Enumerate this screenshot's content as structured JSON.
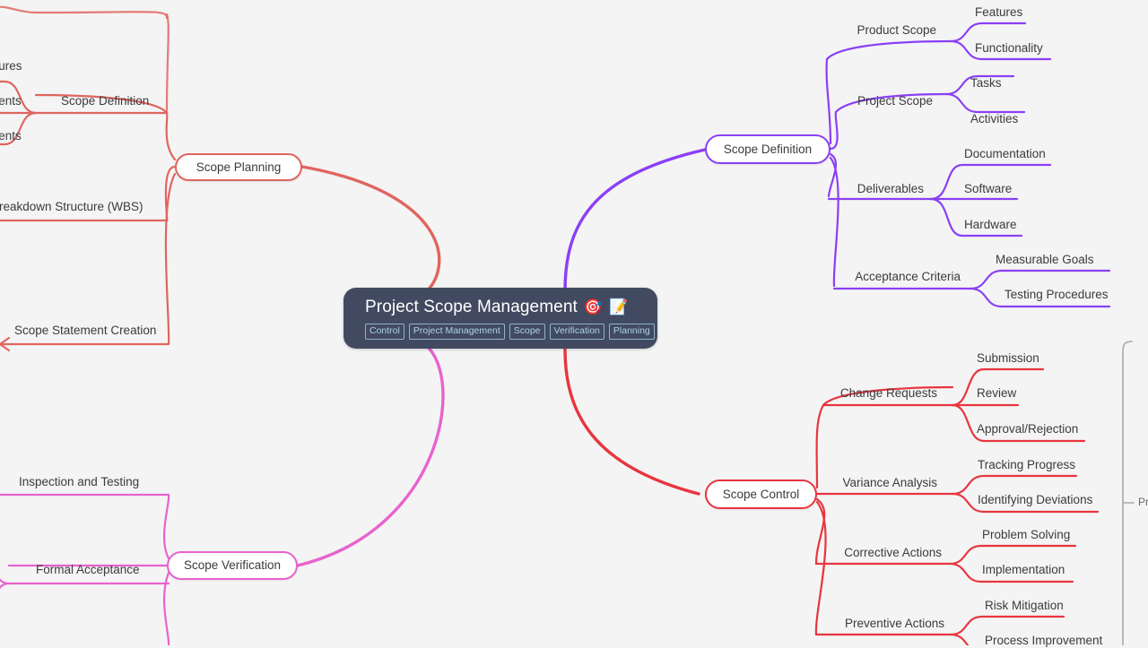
{
  "canvas": {
    "background": "#f4f4f4",
    "type": "mind-map"
  },
  "root": {
    "title": "Project Scope Management",
    "emoji_target": "🎯",
    "emoji_memo": "📝",
    "icon_target_name": "target-icon",
    "icon_memo_name": "memo-icon",
    "background": "#414a60",
    "text_color": "#ffffff",
    "tags": [
      "Control",
      "Project Management",
      "Scope",
      "Verification",
      "Planning"
    ],
    "tag_color": "#aed2e6",
    "tag_border": "#8fb4cc"
  },
  "branches": [
    {
      "id": "scope-planning",
      "label": "Scope Planning",
      "color": "#e0655f",
      "position": "left-top",
      "children": [
        {
          "label": "Scope Definition",
          "leaves": [
            "...ures",
            "...ents",
            "...ents"
          ]
        },
        {
          "label": "Breakdown Structure (WBS)",
          "leaves": []
        },
        {
          "label": "Scope Statement Creation",
          "leaves": []
        }
      ]
    },
    {
      "id": "scope-definition",
      "label": "Scope Definition",
      "color": "#8b3ff5",
      "position": "right-top",
      "children": [
        {
          "label": "Product Scope",
          "leaves": [
            "Features",
            "Functionality"
          ]
        },
        {
          "label": "Project Scope",
          "leaves": [
            "Tasks",
            "Activities"
          ]
        },
        {
          "label": "Deliverables",
          "leaves": [
            "Documentation",
            "Software",
            "Hardware"
          ]
        },
        {
          "label": "Acceptance Criteria",
          "leaves": [
            "Measurable Goals",
            "Testing Procedures"
          ]
        }
      ]
    },
    {
      "id": "scope-verification",
      "label": "Scope Verification",
      "color": "#e763ce",
      "position": "left-bottom",
      "children": [
        {
          "label": "Inspection and Testing",
          "leaves": []
        },
        {
          "label": "Formal Acceptance",
          "leaves": []
        }
      ]
    },
    {
      "id": "scope-control",
      "label": "Scope Control",
      "color": "#e8353f",
      "position": "right-bottom",
      "children": [
        {
          "label": "Change Requests",
          "leaves": [
            "Submission",
            "Review",
            "Approval/Rejection"
          ]
        },
        {
          "label": "Variance Analysis",
          "leaves": [
            "Tracking Progress",
            "Identifying Deviations"
          ]
        },
        {
          "label": "Corrective Actions",
          "leaves": [
            "Problem Solving",
            "Implementation"
          ]
        },
        {
          "label": "Preventive Actions",
          "leaves": [
            "Risk Mitigation",
            "Process Improvement"
          ]
        }
      ]
    }
  ],
  "bracket": {
    "label": "Pr",
    "color": "#a8a8a8"
  }
}
